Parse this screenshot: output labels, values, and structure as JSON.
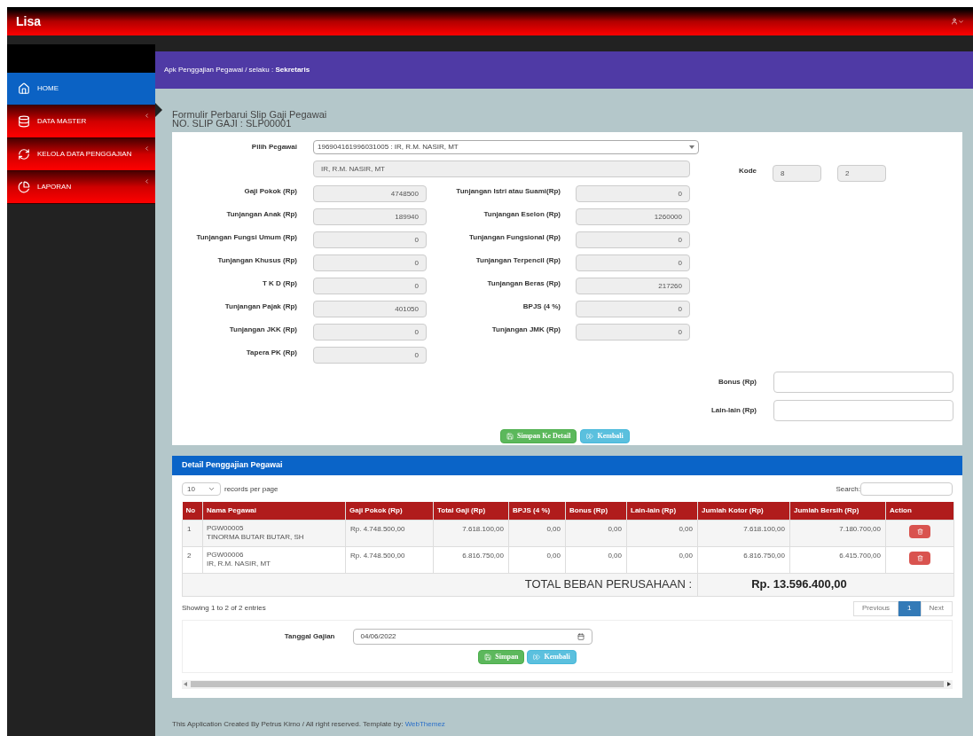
{
  "header": {
    "brand": "Lisa"
  },
  "sidebar": {
    "items": [
      {
        "label": "HOME",
        "selected": true,
        "has_submenu": false
      },
      {
        "label": "DATA MASTER",
        "selected": false,
        "has_submenu": true
      },
      {
        "label": "KELOLA DATA PENGGAJIAN",
        "selected": false,
        "has_submenu": true
      },
      {
        "label": "LAPORAN",
        "selected": false,
        "has_submenu": true
      }
    ]
  },
  "breadcrumb": "Apk Penggajian Pegawai / selaku : **Sekretaris**",
  "form": {
    "title": "Formulir Perbarui Slip Gaji Pegawai",
    "subtitle": "NO. SLIP GAJI : SLP00001",
    "employee_select": {
      "label": "Pilih Pegawai",
      "value": "196904161996031005 : IR, R.M. NASIR, MT"
    },
    "employee_name": "IR, R.M. NASIR, MT",
    "kode": {
      "label": "Kode",
      "values": [
        "8",
        "2"
      ]
    },
    "fields": [
      {
        "left": {
          "label": "Gaji Pokok (Rp)",
          "value": "4748500"
        },
        "right": {
          "label": "Tunjangan Istri atau Suami(Rp)",
          "value": "0"
        }
      },
      {
        "left": {
          "label": "Tunjangan Anak (Rp)",
          "value": "189940"
        },
        "right": {
          "label": "Tunjangan Eselon (Rp)",
          "value": "1260000"
        }
      },
      {
        "left": {
          "label": "Tunjangan Fungsi Umum (Rp)",
          "value": "0"
        },
        "right": {
          "label": "Tunjangan Fungsional (Rp)",
          "value": "0"
        }
      },
      {
        "left": {
          "label": "Tunjangan Khusus (Rp)",
          "value": "0"
        },
        "right": {
          "label": "Tunjangan Terpencil (Rp)",
          "value": "0"
        }
      },
      {
        "left": {
          "label": "T K D (Rp)",
          "value": "0"
        },
        "right": {
          "label": "Tunjangan Beras (Rp)",
          "value": "217260"
        }
      },
      {
        "left": {
          "label": "Tunjangan Pajak (Rp)",
          "value": "401050"
        },
        "right": {
          "label": "BPJS (4 %)",
          "value": "0"
        }
      },
      {
        "left": {
          "label": "Tunjangan JKK (Rp)",
          "value": "0"
        },
        "right": {
          "label": "Tunjangan JMK (Rp)",
          "value": "0"
        }
      },
      {
        "left": {
          "label": "Tapera PK (Rp)",
          "value": "0"
        }
      }
    ],
    "extra_fields": [
      {
        "label": "Bonus (Rp)"
      },
      {
        "label": "Lain-lain (Rp)"
      }
    ],
    "buttons": [
      {
        "label": "Simpan Ke Detail",
        "kind": "save"
      },
      {
        "label": "Kembali",
        "kind": "back"
      }
    ]
  },
  "detail": {
    "title": "Detail Penggajian Pegawai",
    "page_length": "10",
    "page_length_label": "records per page",
    "search_label": "Search:",
    "columns": [
      "No",
      "Nama Pegawai",
      "Gaji Pokok (Rp)",
      "Total Gaji (Rp)",
      "BPJS (4 %)",
      "Bonus (Rp)",
      "Lain-lain (Rp)",
      "Jumlah Kotor (Rp)",
      "Jumlah Bersih (Rp)",
      "Action"
    ],
    "rows": [
      {
        "no": "1",
        "code": "PGW00005",
        "name": "TINORMA BUTAR BUTAR, SH",
        "gaji_pokok": "Rp. 4.748.500,00",
        "total": "7.618.100,00",
        "bpjs": "0,00",
        "bonus": "0,00",
        "lain": "0,00",
        "kotor": "7.618.100,00",
        "bersih": "7.180.700,00"
      },
      {
        "no": "2",
        "code": "PGW00006",
        "name": "IR, R.M. NASIR, MT",
        "gaji_pokok": "Rp. 4.748.500,00",
        "total": "6.816.750,00",
        "bpjs": "0,00",
        "bonus": "0,00",
        "lain": "0,00",
        "kotor": "6.816.750,00",
        "bersih": "6.415.700,00"
      }
    ],
    "total_label": "TOTAL BEBAN PERUSAHAAN :",
    "total_value": "Rp. 13.596.400,00",
    "info": "Showing 1 to 2 of 2 entries",
    "pagination": [
      {
        "label": "Previous",
        "selected": false
      },
      {
        "label": "1",
        "selected": true
      },
      {
        "label": "Next",
        "selected": false
      }
    ],
    "date": {
      "label": "Tanggal Gajian",
      "value": "04/06/2022"
    },
    "buttons": [
      {
        "label": "Simpan",
        "kind": "save"
      },
      {
        "label": "Kembali",
        "kind": "back"
      }
    ]
  },
  "footer": {
    "text": "This Application Created By Petrus Kirno / All right reserved. Template by:",
    "link": "WebThemez"
  }
}
